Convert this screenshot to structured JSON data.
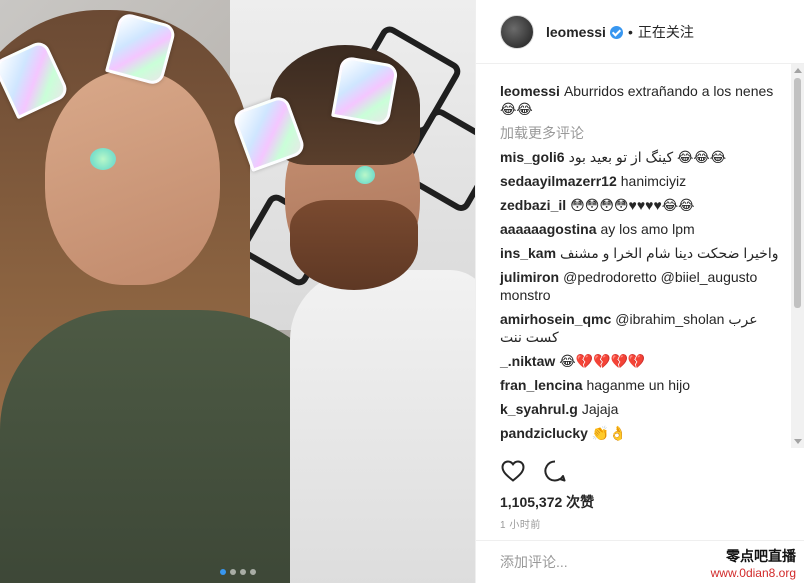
{
  "post": {
    "username": "leomessi",
    "separator": "•",
    "follow_status": "正在关注",
    "caption_user": "leomessi",
    "caption_text": "Aburridos extrañando a los nenes 😂😂",
    "load_more": "加载更多评论",
    "likes": "1,105,372 次赞",
    "time_ago": "1 小时前",
    "add_comment_placeholder": "添加评论...",
    "carousel_dots": 4,
    "carousel_active": 1
  },
  "comments": [
    {
      "user": "mis_goli6",
      "text": "کینگ از تو بعید بود 😂😂😂"
    },
    {
      "user": "sedaayilmazerr12",
      "text": "hanimciyiz"
    },
    {
      "user": "zedbazi_il",
      "text": "😳😳😳😳♥♥♥♥😂😂"
    },
    {
      "user": "aaaaaagostina",
      "text": "ay los amo lpm"
    },
    {
      "user": "ins_kam",
      "text": "واخیرا ضحکت دینا شام الخرا و مشنف"
    },
    {
      "user": "julimiron",
      "text": "@pedrodoretto @biiel_augusto monstro"
    },
    {
      "user": "amirhosein_qmc",
      "text": "@ibrahim_sholan عرب کست ننت"
    },
    {
      "user": "_.niktaw",
      "text": "😂💔💔💔💔"
    },
    {
      "user": "fran_lencina",
      "text": "haganme un hijo"
    },
    {
      "user": "k_syahrul.g",
      "text": "Jajaja"
    },
    {
      "user": "pandziclucky",
      "text": "👏👌"
    }
  ],
  "watermark": {
    "line1": "零点吧直播",
    "line2": "www.0dian8.org"
  },
  "colors": {
    "verified": "#3897f0",
    "muted": "#999999",
    "text": "#262626"
  },
  "icons": {
    "like": "heart-outline-icon",
    "comment": "speech-bubble-icon"
  }
}
